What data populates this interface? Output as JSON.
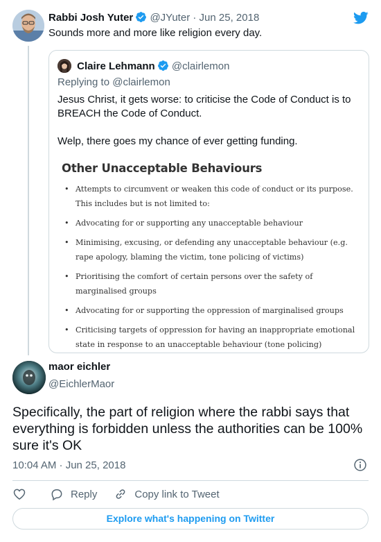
{
  "parent": {
    "name": "Rabbi Josh Yuter",
    "handle": "@JYuter",
    "sep": "·",
    "date": "Jun 25, 2018",
    "text": "Sounds more and more like religion every day."
  },
  "quote": {
    "name": "Claire Lehmann",
    "handle": "@clairlemon",
    "replying_to": "Replying to @clairlemon",
    "text_1": "Jesus Christ, it gets worse: to criticise the Code of Conduct is to BREACH the Code of Conduct.",
    "text_2": "Welp, there goes my chance of ever getting funding.",
    "image": {
      "heading": "Other Unacceptable Behaviours",
      "items": [
        "Attempts to circumvent or weaken this code of conduct or its purpose. This includes but is not limited to:",
        "Advocating for or supporting any unacceptable behaviour",
        "Minimising, excusing, or defending any unacceptable behaviour (e.g. rape apology, blaming the victim, tone policing of victims)",
        "Prioritising the comfort of certain persons over the safety of marginalised groups",
        "Advocating for or supporting the oppression of marginalised groups",
        "Criticising targets of oppression for having an inappropriate emotional state in response to an unacceptable behaviour (tone policing)"
      ]
    }
  },
  "reply": {
    "name": "maor eichler",
    "handle": "@EichlerMaor",
    "text": "Specifically, the part of religion where the rabbi says that everything is forbidden unless the authorities can be 100% sure it's OK",
    "time": "10:04 AM · Jun 25, 2018",
    "actions": {
      "reply": "Reply",
      "copy_link": "Copy link to Tweet"
    },
    "explore": "Explore what's happening on Twitter"
  },
  "colors": {
    "accent": "#1d9bf0",
    "muted": "#536471",
    "border": "#cfd9de"
  },
  "icons": {
    "logo": "twitter-bird-icon",
    "verified": "verified-badge-icon",
    "like": "heart-icon",
    "reply": "speech-bubble-icon",
    "copy_link": "link-icon",
    "info": "info-icon"
  }
}
